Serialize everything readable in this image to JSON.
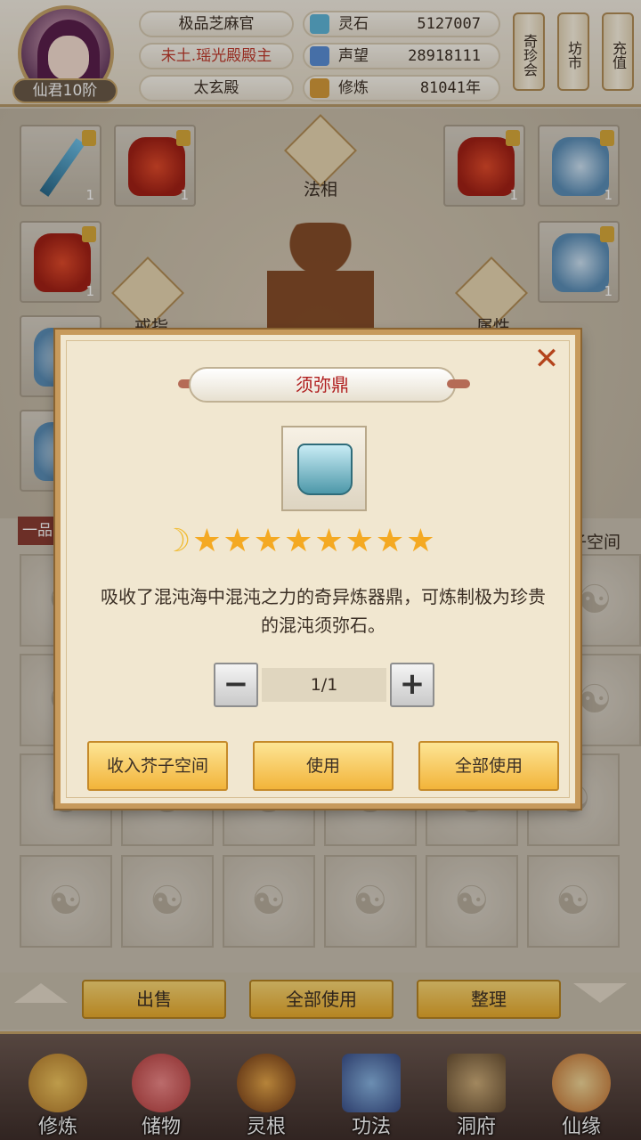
{
  "header": {
    "rank": "仙君10阶",
    "titles": [
      "极品芝麻官",
      "未土.瑶光殿殿主",
      "太玄殿"
    ],
    "stats": [
      {
        "label": "灵石",
        "value": "5127007",
        "icon": "spirit-stone-icon",
        "color": "#5fb6d9"
      },
      {
        "label": "声望",
        "value": "28918111",
        "icon": "prestige-icon",
        "color": "#5a8fd6"
      },
      {
        "label": "修炼",
        "value": "81041年",
        "icon": "cultivation-icon",
        "color": "#d69b3a"
      }
    ],
    "scroll_buttons": [
      "奇珍会",
      "坊市",
      "充值"
    ]
  },
  "equipment": {
    "labels": {
      "faxiang": "法相",
      "ring": "戒指",
      "attribute": "属性"
    },
    "slot_qty": "1"
  },
  "inventory": {
    "tab_left": "一品",
    "tab_right": "子空间"
  },
  "dialog": {
    "title": "须弥鼎",
    "stars": "★★★★★★★★",
    "moon": "☽",
    "description": "吸收了混沌海中混沌之力的奇异炼器鼎，可炼制极为珍贵的混沌须弥石。",
    "quantity": "1/1",
    "minus": "−",
    "plus": "+",
    "close": "✕",
    "buttons": [
      "收入芥子空间",
      "使用",
      "全部使用"
    ]
  },
  "action_bar": [
    "出售",
    "全部使用",
    "整理"
  ],
  "bottom_nav": [
    "修炼",
    "储物",
    "灵根",
    "功法",
    "洞府",
    "仙缘"
  ],
  "colors": {
    "accent_gold": "#f2b43a",
    "title_red": "#b01e1e",
    "close_orange": "#b4441c",
    "star_gold": "#f4a922"
  }
}
